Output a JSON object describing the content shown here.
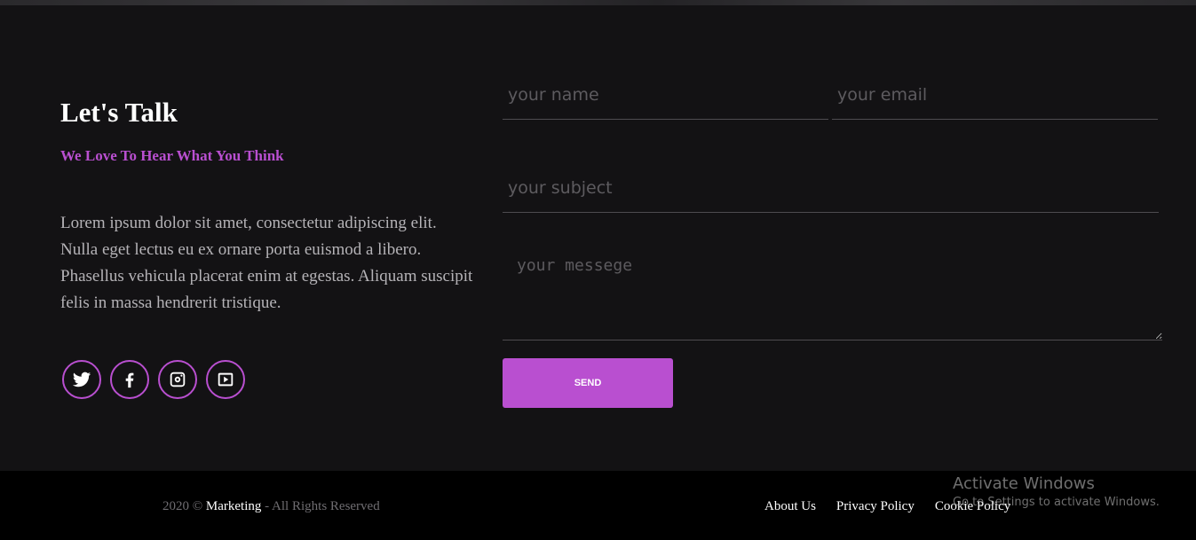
{
  "contact": {
    "title": "Let's Talk",
    "subtitle": "We Love To Hear What You Think",
    "paragraph": "Lorem ipsum dolor sit amet, consectetur adipiscing elit. Nulla eget lectus eu ex ornare porta euismod a libero. Phasellus vehicula placerat enim at egestas. Aliquam suscipit felis in massa hendrerit tristique.",
    "socials": [
      "twitter-icon",
      "facebook-icon",
      "instagram-icon",
      "youtube-icon"
    ],
    "accent_color": "#b94fd0"
  },
  "form": {
    "name_placeholder": "your name",
    "email_placeholder": "your email",
    "subject_placeholder": "your subject",
    "message_placeholder": "your messege",
    "send_label": "SEND"
  },
  "footer": {
    "copyright_prefix": "2020 ©",
    "brand": "Marketing",
    "copyright_suffix": "- All Rights Reserved",
    "links": [
      "About Us",
      "Privacy Policy",
      "Cookie Policy"
    ]
  },
  "watermark": {
    "title": "Activate Windows",
    "subtitle": "Go to Settings to activate Windows."
  }
}
